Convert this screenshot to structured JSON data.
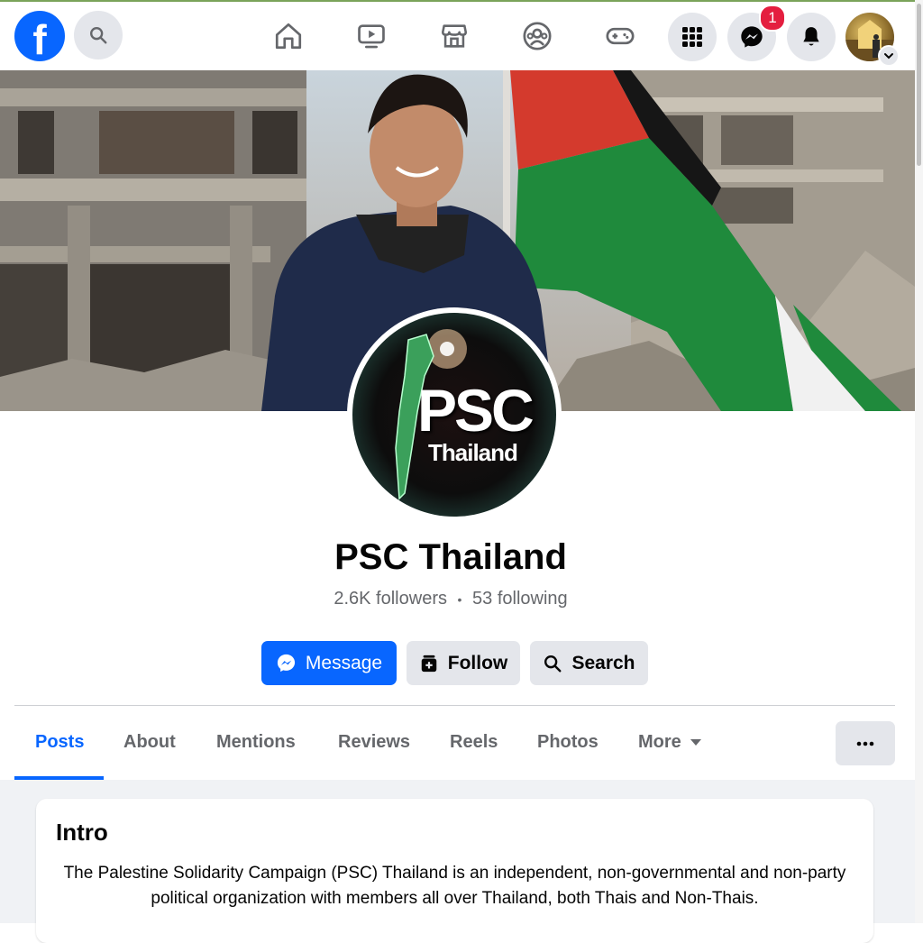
{
  "topbar": {
    "logo": "f",
    "notifications": {
      "messenger_badge": "1"
    },
    "icons": [
      "search-icon",
      "home-icon",
      "video-icon",
      "marketplace-icon",
      "groups-icon",
      "gaming-icon",
      "menu-grid-icon",
      "messenger-icon",
      "bell-icon",
      "chevron-down-icon"
    ]
  },
  "profile": {
    "name": "PSC Thailand",
    "followers": "2.6K followers",
    "separator": "•",
    "following": "53 following",
    "logo_text_main": "PSC",
    "logo_text_sub": "Thailand"
  },
  "actions": {
    "message": "Message",
    "follow": "Follow",
    "search": "Search"
  },
  "tabs": [
    {
      "label": "Posts",
      "active": true
    },
    {
      "label": "About"
    },
    {
      "label": "Mentions"
    },
    {
      "label": "Reviews"
    },
    {
      "label": "Reels"
    },
    {
      "label": "Photos"
    },
    {
      "label": "More"
    }
  ],
  "intro": {
    "title": "Intro",
    "text": "The Palestine Solidarity Campaign (PSC) Thailand is an independent, non-governmental and non-party political organization with members all over Thailand, both Thais and Non-Thais."
  },
  "colors": {
    "accent": "#0866ff",
    "badge": "#e41e3f"
  }
}
